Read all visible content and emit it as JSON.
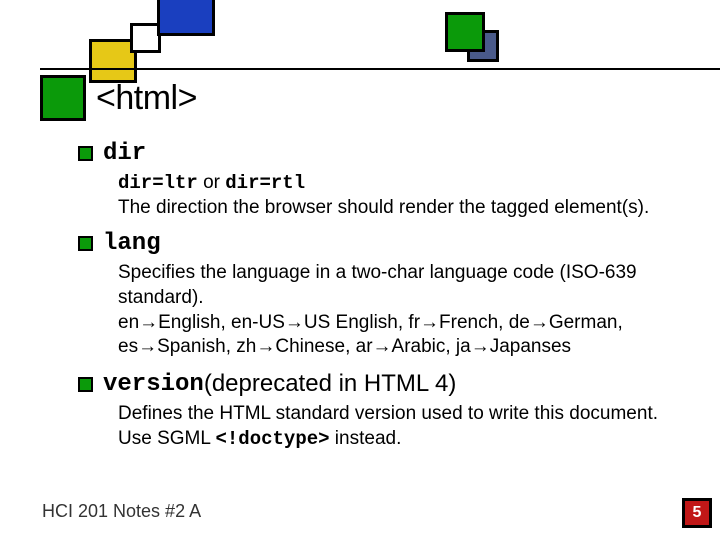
{
  "header": {
    "title": "<html>"
  },
  "items": [
    {
      "term": "dir",
      "desc1_code_a": "dir=ltr",
      "desc1_mid": " or ",
      "desc1_code_b": "dir=rtl",
      "desc2": "The direction the browser should render the tagged element(s)."
    },
    {
      "term": "lang",
      "desc1": "Specifies the language in a two-char language code (ISO-639 standard).",
      "desc2": "en→English, en-US→US English, fr→French,  de→German, es→Spanish, zh→Chinese, ar→Arabic, ja→Japanses"
    },
    {
      "term": "version",
      "term_suffix": " (deprecated in HTML 4)",
      "desc1_pre": "Defines the HTML standard version used to write this document. Use SGML ",
      "desc1_code": "<!doctype>",
      "desc1_post": " instead."
    }
  ],
  "footer": {
    "left": "HCI 201 Notes #2 A",
    "page": "5"
  }
}
